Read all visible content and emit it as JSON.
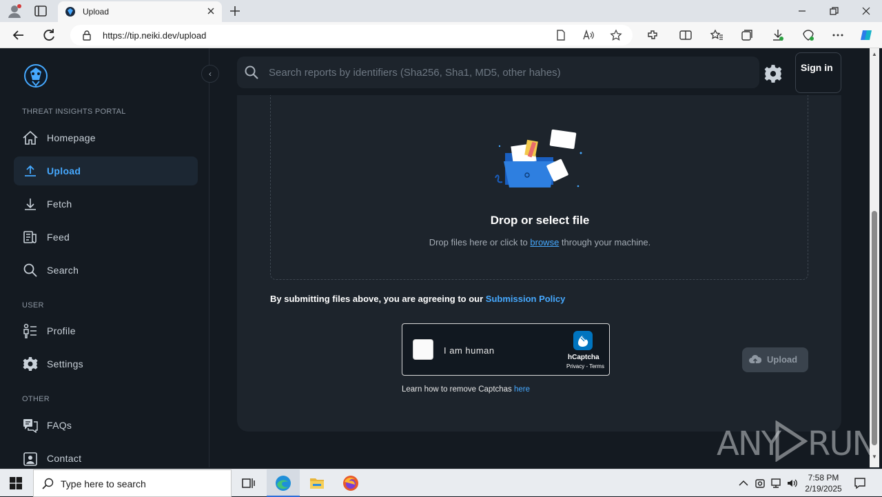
{
  "browser": {
    "tab_title": "Upload",
    "url": "https://tip.neiki.dev/upload"
  },
  "sidebar": {
    "collapse_icon": "chevron-left-icon",
    "sections": [
      {
        "label": "THREAT INSIGHTS PORTAL"
      },
      {
        "label": "USER"
      },
      {
        "label": "OTHER"
      }
    ],
    "items": [
      {
        "label": "Homepage",
        "icon": "home-icon"
      },
      {
        "label": "Upload",
        "icon": "upload-icon",
        "active": true
      },
      {
        "label": "Fetch",
        "icon": "download-icon"
      },
      {
        "label": "Feed",
        "icon": "feed-icon"
      },
      {
        "label": "Search",
        "icon": "search-icon"
      },
      {
        "label": "Profile",
        "icon": "profile-icon"
      },
      {
        "label": "Settings",
        "icon": "gear-icon"
      },
      {
        "label": "FAQs",
        "icon": "faq-icon"
      },
      {
        "label": "Contact",
        "icon": "contact-icon"
      }
    ]
  },
  "header": {
    "search_placeholder": "Search reports by identifiers (Sha256, Sha1, MD5, other hahes)",
    "sign_in_label": "Sign in"
  },
  "upload": {
    "drop_title": "Drop or select file",
    "drop_sub_before": "Drop files here or click to ",
    "drop_sub_link": "browse",
    "drop_sub_after": " through your machine.",
    "policy_text": "By submitting files above, you are agreeing to our ",
    "policy_link": "Submission Policy",
    "captcha_label": "I am human",
    "captcha_brand": "hCaptcha",
    "captcha_links": "Privacy - Terms",
    "remove_captcha_text": "Learn how to remove Captchas ",
    "remove_captcha_link": "here",
    "upload_button": "Upload"
  },
  "watermark": {
    "left": "ANY",
    "right": "RUN"
  },
  "taskbar": {
    "search_placeholder": "Type here to search",
    "time": "7:58 PM",
    "date": "2/19/2025"
  },
  "colors": {
    "accent": "#46a9ff",
    "page_bg": "#141a21",
    "card_bg": "#1d242c"
  }
}
